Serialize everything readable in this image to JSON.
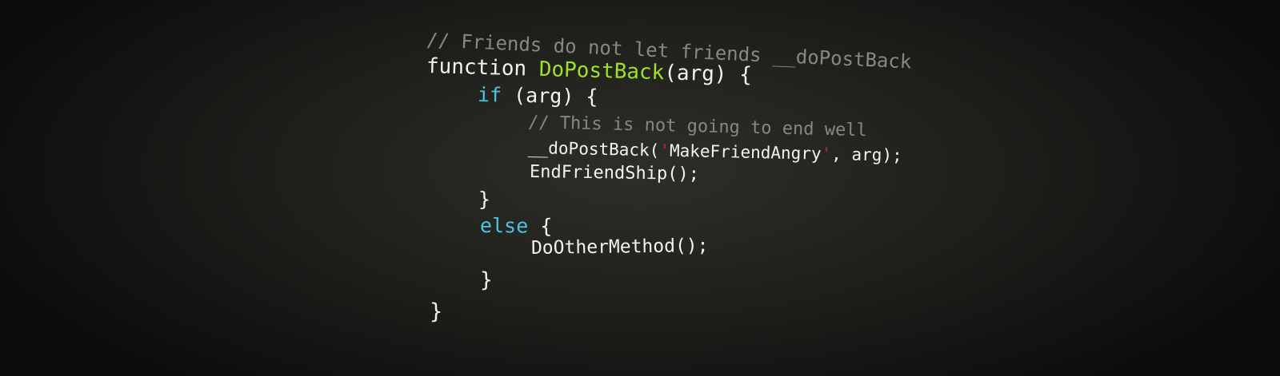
{
  "code": {
    "line1_comment": "// Friends do not let friends __doPostBack",
    "line2_keyword": "function",
    "line2_name": "DoPostBack",
    "line2_rest": "(arg) {",
    "line3_keyword": "if",
    "line3_rest": " (arg) {",
    "line4_comment": "// This is not going to end well",
    "line5_call": "__doPostBack(",
    "line5_quote_open": "'",
    "line5_string": "MakeFriendAngry",
    "line5_quote_close": "'",
    "line5_rest": ", arg);",
    "line6": "EndFriendShip();",
    "line7": "}",
    "line8_keyword": "else",
    "line8_rest": " {",
    "line9": "DoOtherMethod();",
    "line10": "}",
    "line11": "}"
  },
  "colors": {
    "comment": "#8a887a",
    "function_name": "#9ee02a",
    "keyword": "#4cc3e0",
    "quote": "#c2185b",
    "text": "#f2f2ee"
  }
}
